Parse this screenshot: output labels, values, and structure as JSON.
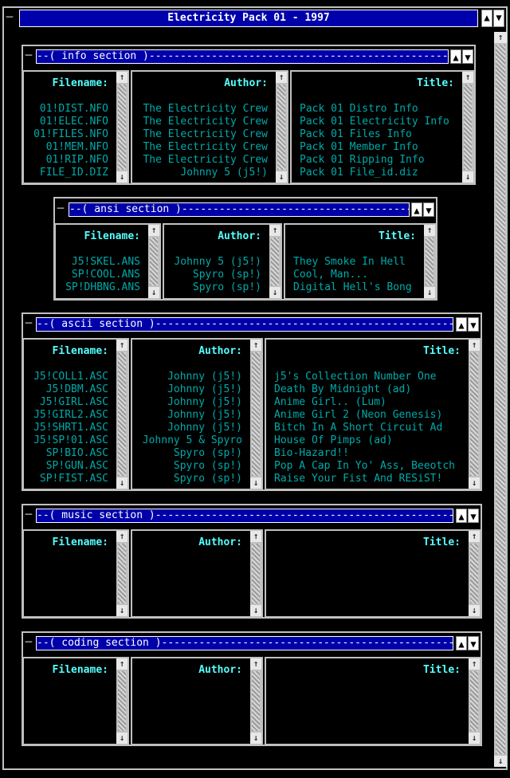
{
  "window": {
    "title": "Electricity Pack 01 - 1997",
    "close_glyph": "─",
    "up_glyph": "▲",
    "down_glyph": "▼"
  },
  "scroll": {
    "up": "↑",
    "down": "↓"
  },
  "sections": [
    {
      "title": "--( info section )--------------------------------------------------",
      "headers": {
        "filename": "Filename:",
        "author": "Author:",
        "title": "Title:"
      },
      "filenames": "01!DIST.NFO\n01!ELEC.NFO\n01!FILES.NFO\n01!MEM.NFO\n01!RIP.NFO\nFILE_ID.DIZ",
      "authors": "The Electricity Crew\nThe Electricity Crew\nThe Electricity Crew\nThe Electricity Crew\nThe Electricity Crew\nJohnny 5 (j5!)",
      "titles": "Pack 01 Distro Info\nPack 01 Electricity Info\nPack 01 Files Info\nPack 01 Member Info\nPack 01 Ripping Info\nPack 01 File_id.diz"
    },
    {
      "title": "--( ansi section )--------------------------------------------------",
      "headers": {
        "filename": "Filename:",
        "author": "Author:",
        "title": "Title:"
      },
      "filenames": "J5!SKEL.ANS\nSP!COOL.ANS\nSP!DHBNG.ANS",
      "authors": "Johnny 5 (j5!)\nSpyro (sp!)\nSpyro (sp!)",
      "titles": "They Smoke In Hell\nCool, Man...\nDigital Hell's Bong"
    },
    {
      "title": "--( ascii section )--------------------------------------------------",
      "headers": {
        "filename": "Filename:",
        "author": "Author:",
        "title": "Title:"
      },
      "filenames": "J5!COLL1.ASC\nJ5!DBM.ASC\nJ5!GIRL.ASC\nJ5!GIRL2.ASC\nJ5!SHRT1.ASC\nJ5!SP!01.ASC\nSP!BIO.ASC\nSP!GUN.ASC\nSP!FIST.ASC",
      "authors": "Johnny (j5!)\nJohnny (j5!)\nJohnny (j5!)\nJohnny (j5!)\nJohnny (j5!)\nJohnny 5 & Spyro\nSpyro (sp!)\nSpyro (sp!)\nSpyro (sp!)",
      "titles": "j5's Collection Number One\nDeath By Midnight (ad)\nAnime Girl.. (Lum)\nAnime Girl 2 (Neon Genesis)\nBitch In A Short Circuit Ad\nHouse Of Pimps (ad)\nBio-Hazard!!\nPop A Cap In Yo' Ass, Beeotch\nRaise Your Fist And RESiST!"
    },
    {
      "title": "--( music section )--------------------------------------------------",
      "headers": {
        "filename": "Filename:",
        "author": "Author:",
        "title": "Title:"
      },
      "filenames": "",
      "authors": "",
      "titles": ""
    },
    {
      "title": "--( coding section )--------------------------------------------------",
      "headers": {
        "filename": "Filename:",
        "author": "Author:",
        "title": "Title:"
      },
      "filenames": "",
      "authors": "",
      "titles": ""
    }
  ]
}
